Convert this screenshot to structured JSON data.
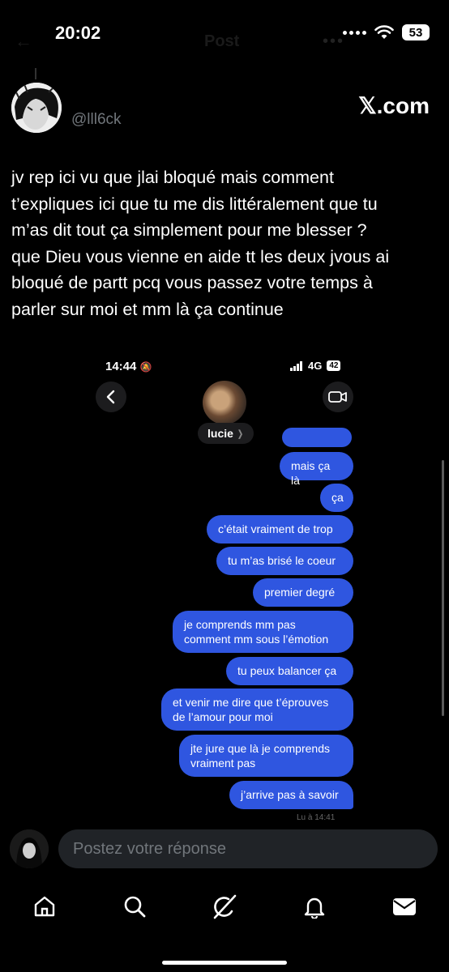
{
  "status_bar": {
    "time": "20:02",
    "battery": "53"
  },
  "ghost_header": {
    "title": "Post"
  },
  "post": {
    "handle": "@lll6ck",
    "source": "𝕏.com",
    "text": "jv rep ici vu que jlai bloqué mais comment\nt’expliques ici que tu me dis littéralement que tu\nm’as dit tout ça simplement pour me blesser ?\nque Dieu vous vienne en aide tt les deux jvous ai\nbloqué de partt pcq vous passez votre temps à\nparler sur moi et mm là ça continue"
  },
  "embedded": {
    "time": "14:44",
    "network": "4G",
    "battery": "42",
    "contact_name": "lucie",
    "messages": [
      "mais ça là",
      "ça",
      "c’était vraiment de trop",
      "tu m’as brisé le coeur",
      "premier degré",
      "je comprends mm pas\ncomment mm sous l’émotion",
      "tu peux balancer ça",
      "et venir me dire que t’éprouves\nde l’amour pour moi",
      "jte jure que là je comprends\nvraiment pas",
      "j’arrive pas à savoir"
    ],
    "seen_label": "Lu à 14:41"
  },
  "reply": {
    "placeholder": "Postez votre réponse"
  },
  "tabbar": {
    "icons": [
      "home-icon",
      "search-icon",
      "grok-icon",
      "notifications-icon",
      "messages-icon"
    ]
  }
}
